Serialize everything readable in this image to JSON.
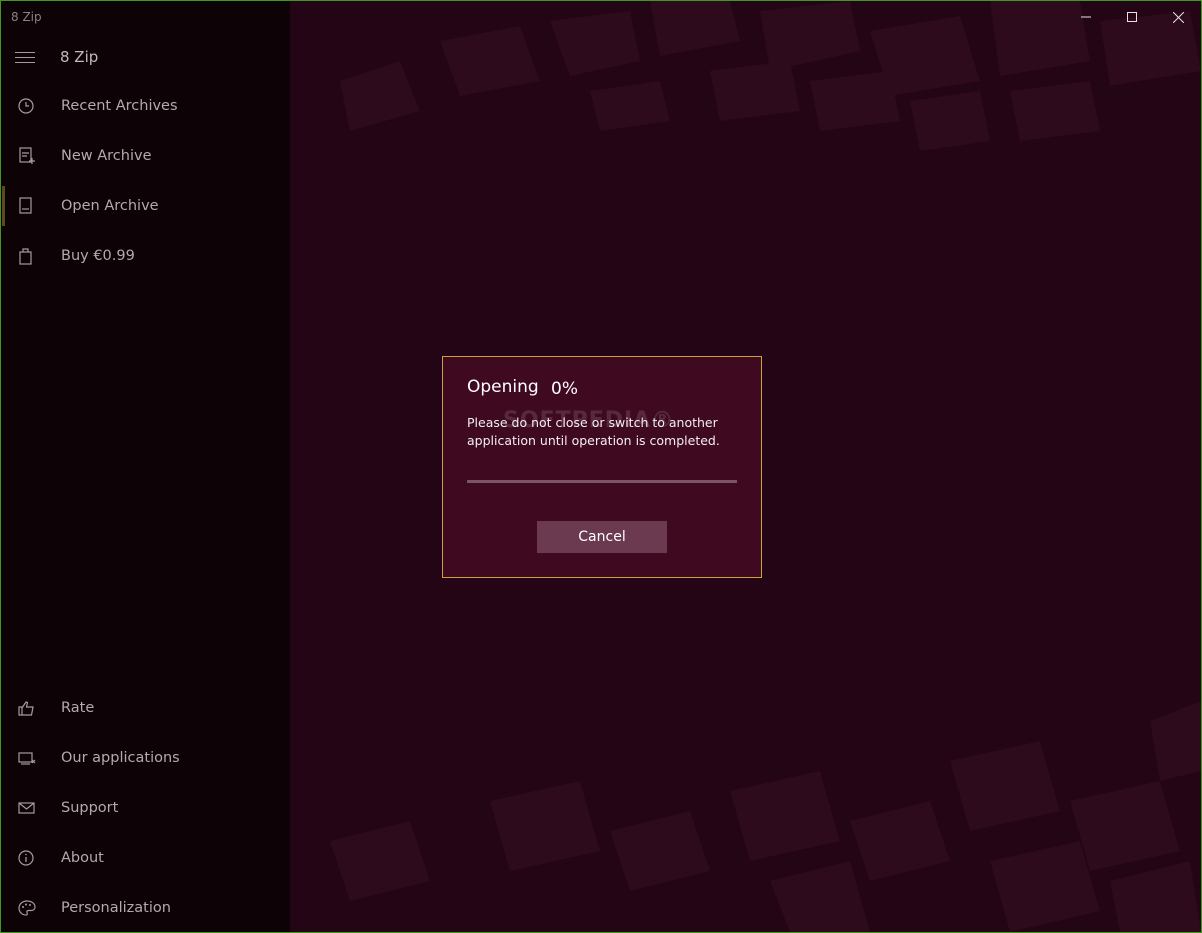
{
  "window": {
    "title": "8 Zip"
  },
  "sidebar": {
    "app_name": "8 Zip",
    "top_items": [
      {
        "label": "Recent Archives",
        "icon": "clock-icon"
      },
      {
        "label": "New Archive",
        "icon": "new-archive-icon"
      },
      {
        "label": "Open Archive",
        "icon": "open-archive-icon"
      },
      {
        "label": "Buy €0.99",
        "icon": "shopping-bag-icon"
      }
    ],
    "bottom_items": [
      {
        "label": "Rate",
        "icon": "thumbs-up-icon"
      },
      {
        "label": "Our applications",
        "icon": "applications-icon"
      },
      {
        "label": "Support",
        "icon": "mail-icon"
      },
      {
        "label": "About",
        "icon": "info-icon"
      },
      {
        "label": "Personalization",
        "icon": "palette-icon"
      }
    ]
  },
  "dialog": {
    "title": "Opening",
    "percent": "0%",
    "progress_fraction": 0,
    "message": "Please do not close or switch to another application until operation is completed.",
    "cancel_label": "Cancel",
    "watermark": "SOFTPEDIA®"
  },
  "colors": {
    "background": "#230515",
    "sidebar": "#0d0307",
    "dialog": "#3f0a20",
    "dialog_border": "#c8a23a",
    "button": "#6b3a50",
    "window_border": "#3d9a1c"
  }
}
